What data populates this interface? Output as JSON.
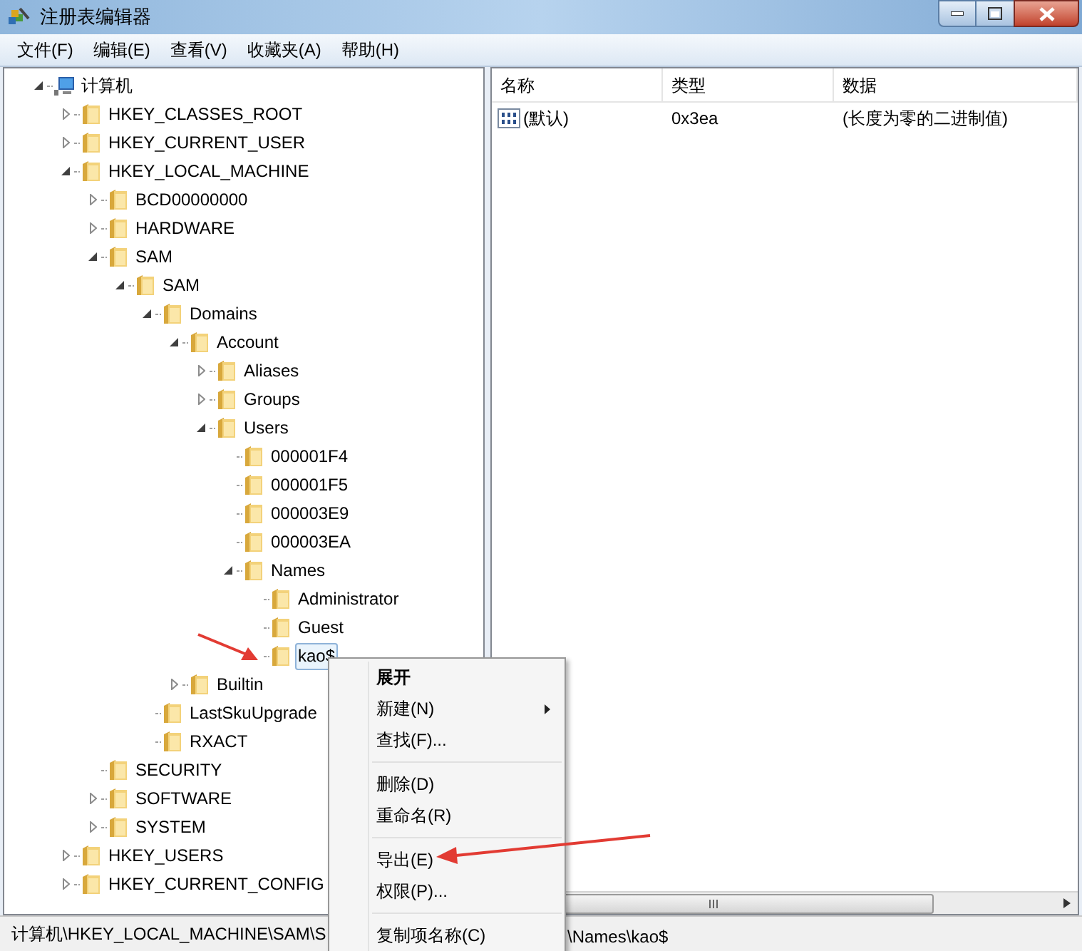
{
  "window": {
    "title": "注册表编辑器"
  },
  "menu": [
    "文件(F)",
    "编辑(E)",
    "查看(V)",
    "收藏夹(A)",
    "帮助(H)"
  ],
  "tree": [
    {
      "label": "计算机",
      "kind": "computer",
      "expanded": true,
      "selected": false,
      "children": [
        {
          "label": "HKEY_CLASSES_ROOT",
          "kind": "folder",
          "expanded": false,
          "selected": false
        },
        {
          "label": "HKEY_CURRENT_USER",
          "kind": "folder",
          "expanded": false,
          "selected": false
        },
        {
          "label": "HKEY_LOCAL_MACHINE",
          "kind": "folder",
          "expanded": true,
          "selected": false,
          "children": [
            {
              "label": "BCD00000000",
              "kind": "folder",
              "expanded": false,
              "selected": false
            },
            {
              "label": "HARDWARE",
              "kind": "folder",
              "expanded": false,
              "selected": false
            },
            {
              "label": "SAM",
              "kind": "folder",
              "expanded": true,
              "selected": false,
              "children": [
                {
                  "label": "SAM",
                  "kind": "folder",
                  "expanded": true,
                  "selected": false,
                  "children": [
                    {
                      "label": "Domains",
                      "kind": "folder",
                      "expanded": true,
                      "selected": false,
                      "children": [
                        {
                          "label": "Account",
                          "kind": "folder",
                          "expanded": true,
                          "selected": false,
                          "children": [
                            {
                              "label": "Aliases",
                              "kind": "folder",
                              "expanded": false,
                              "selected": false
                            },
                            {
                              "label": "Groups",
                              "kind": "folder",
                              "expanded": false,
                              "selected": false
                            },
                            {
                              "label": "Users",
                              "kind": "folder",
                              "expanded": true,
                              "selected": false,
                              "children": [
                                {
                                  "label": "000001F4",
                                  "kind": "folder",
                                  "selected": false
                                },
                                {
                                  "label": "000001F5",
                                  "kind": "folder",
                                  "selected": false
                                },
                                {
                                  "label": "000003E9",
                                  "kind": "folder",
                                  "selected": false
                                },
                                {
                                  "label": "000003EA",
                                  "kind": "folder",
                                  "selected": false
                                },
                                {
                                  "label": "Names",
                                  "kind": "folder",
                                  "expanded": true,
                                  "selected": false,
                                  "children": [
                                    {
                                      "label": "Administrator",
                                      "kind": "folder",
                                      "selected": false
                                    },
                                    {
                                      "label": "Guest",
                                      "kind": "folder",
                                      "selected": false
                                    },
                                    {
                                      "label": "kao$",
                                      "kind": "folder",
                                      "selected": true
                                    }
                                  ]
                                }
                              ]
                            }
                          ]
                        },
                        {
                          "label": "Builtin",
                          "kind": "folder",
                          "expanded": false,
                          "selected": false
                        }
                      ]
                    },
                    {
                      "label": "LastSkuUpgrade",
                      "kind": "folder",
                      "selected": false
                    },
                    {
                      "label": "RXACT",
                      "kind": "folder",
                      "selected": false
                    }
                  ]
                }
              ]
            },
            {
              "label": "SECURITY",
              "kind": "folder",
              "selected": false
            },
            {
              "label": "SOFTWARE",
              "kind": "folder",
              "expanded": false,
              "selected": false
            },
            {
              "label": "SYSTEM",
              "kind": "folder",
              "expanded": false,
              "selected": false
            }
          ]
        },
        {
          "label": "HKEY_USERS",
          "kind": "folder",
          "expanded": false,
          "selected": false
        },
        {
          "label": "HKEY_CURRENT_CONFIG",
          "kind": "folder",
          "expanded": false,
          "selected": false
        }
      ]
    }
  ],
  "values": {
    "columns": [
      "名称",
      "类型",
      "数据"
    ],
    "rows": [
      {
        "name": "(默认)",
        "type": "0x3ea",
        "data": "(长度为零的二进制值)"
      }
    ]
  },
  "context_menu": [
    {
      "kind": "item",
      "label": "展开",
      "default": true,
      "submenu": false
    },
    {
      "kind": "item",
      "label": "新建(N)",
      "default": false,
      "submenu": true
    },
    {
      "kind": "item",
      "label": "查找(F)...",
      "default": false,
      "submenu": false
    },
    {
      "kind": "separator"
    },
    {
      "kind": "item",
      "label": "删除(D)",
      "default": false,
      "submenu": false
    },
    {
      "kind": "item",
      "label": "重命名(R)",
      "default": false,
      "submenu": false
    },
    {
      "kind": "separator"
    },
    {
      "kind": "item",
      "label": "导出(E)",
      "default": false,
      "submenu": false
    },
    {
      "kind": "item",
      "label": "权限(P)...",
      "default": false,
      "submenu": false
    },
    {
      "kind": "separator"
    },
    {
      "kind": "item",
      "label": "复制项名称(C)",
      "default": false,
      "submenu": false
    }
  ],
  "status_bar": [
    "计算机\\HKEY_LOCAL_MACHINE\\SAM\\S",
    "\\Names\\kao$"
  ]
}
